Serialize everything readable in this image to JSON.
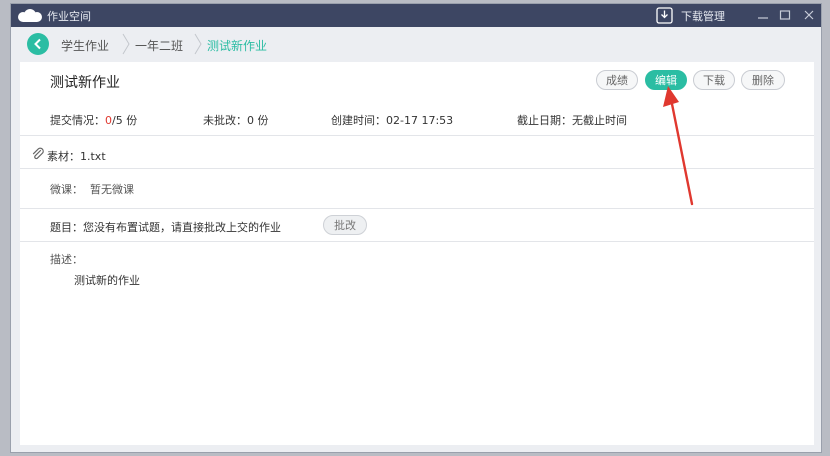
{
  "window": {
    "app_title": "作业空间",
    "download_label": "下载管理",
    "logo_icon": "cloud-logo-icon",
    "download_icon": "download-icon"
  },
  "breadcrumb": {
    "items": [
      {
        "label": "学生作业"
      },
      {
        "label": "一年二班"
      },
      {
        "label": "测试新作业"
      }
    ]
  },
  "homework": {
    "title": "测试新作业",
    "buttons": {
      "grades": "成绩",
      "edit": "编辑",
      "download": "下载",
      "delete": "删除"
    },
    "submission_label": "提交情况：",
    "submission_done": "0",
    "submission_total": "/5 份",
    "ungraded": "未批改：0 份",
    "created": "创建时间：02-17 17:53",
    "deadline": "截止日期：无截止时间",
    "material": "素材：1.txt",
    "microlesson_label": "微课：",
    "microlesson_value": "暂无微课",
    "question_text": "题目：您没有布置试题，请直接批改上交的作业",
    "grade_button": "批改",
    "description_label": "描述：",
    "description_value": "测试新的作业"
  },
  "colors": {
    "accent": "#2bbda3",
    "titlebar": "#3d4663",
    "red": "#e0382f",
    "annotation_arrow": "#e0382f"
  }
}
